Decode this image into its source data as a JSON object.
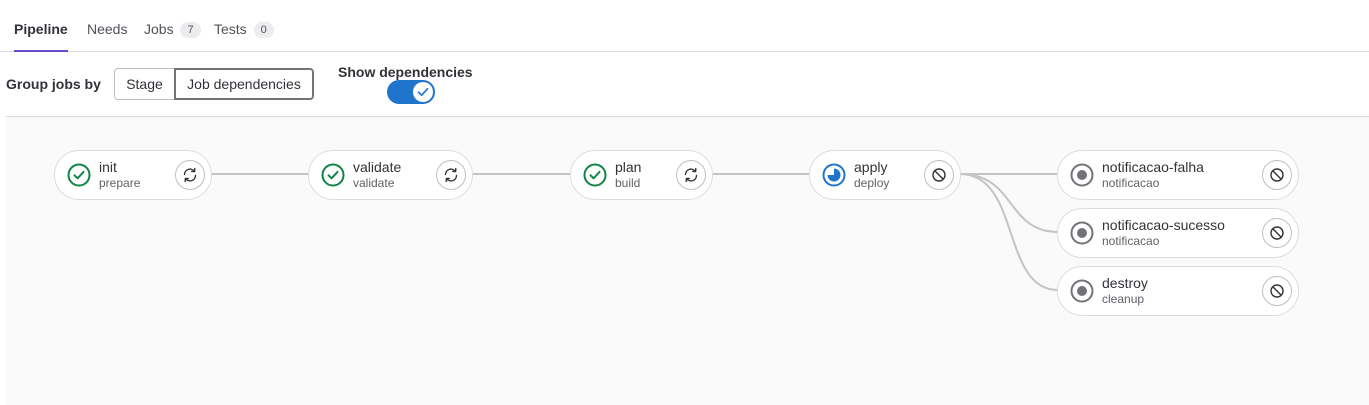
{
  "tabs": [
    {
      "label": "Pipeline",
      "active": true
    },
    {
      "label": "Needs"
    },
    {
      "label": "Jobs",
      "count": "7"
    },
    {
      "label": "Tests",
      "count": "0"
    }
  ],
  "controls": {
    "group_label": "Group jobs by",
    "group_options": [
      "Stage",
      "Job dependencies"
    ],
    "selected_group": "Job dependencies",
    "show_dependencies_label": "Show dependencies",
    "show_dependencies": true
  },
  "colors": {
    "success": "#108548",
    "running": "#1f75cb",
    "created": "#737278",
    "tab_accent": "#6e49cb",
    "toggle_on": "#1f75cb"
  },
  "jobs": [
    {
      "name": "init",
      "stage": "prepare",
      "status": "success",
      "action": "retry-icon"
    },
    {
      "name": "validate",
      "stage": "validate",
      "status": "success",
      "action": "retry-icon"
    },
    {
      "name": "plan",
      "stage": "build",
      "status": "success",
      "action": "retry-icon"
    },
    {
      "name": "apply",
      "stage": "deploy",
      "status": "running",
      "action": "cancel-icon"
    },
    {
      "name": "notificacao-falha",
      "stage": "notificacao",
      "status": "created",
      "action": "cancel-icon"
    },
    {
      "name": "notificacao-sucesso",
      "stage": "notificacao",
      "status": "created",
      "action": "cancel-icon"
    },
    {
      "name": "destroy",
      "stage": "cleanup",
      "status": "created",
      "action": "cancel-icon"
    }
  ]
}
